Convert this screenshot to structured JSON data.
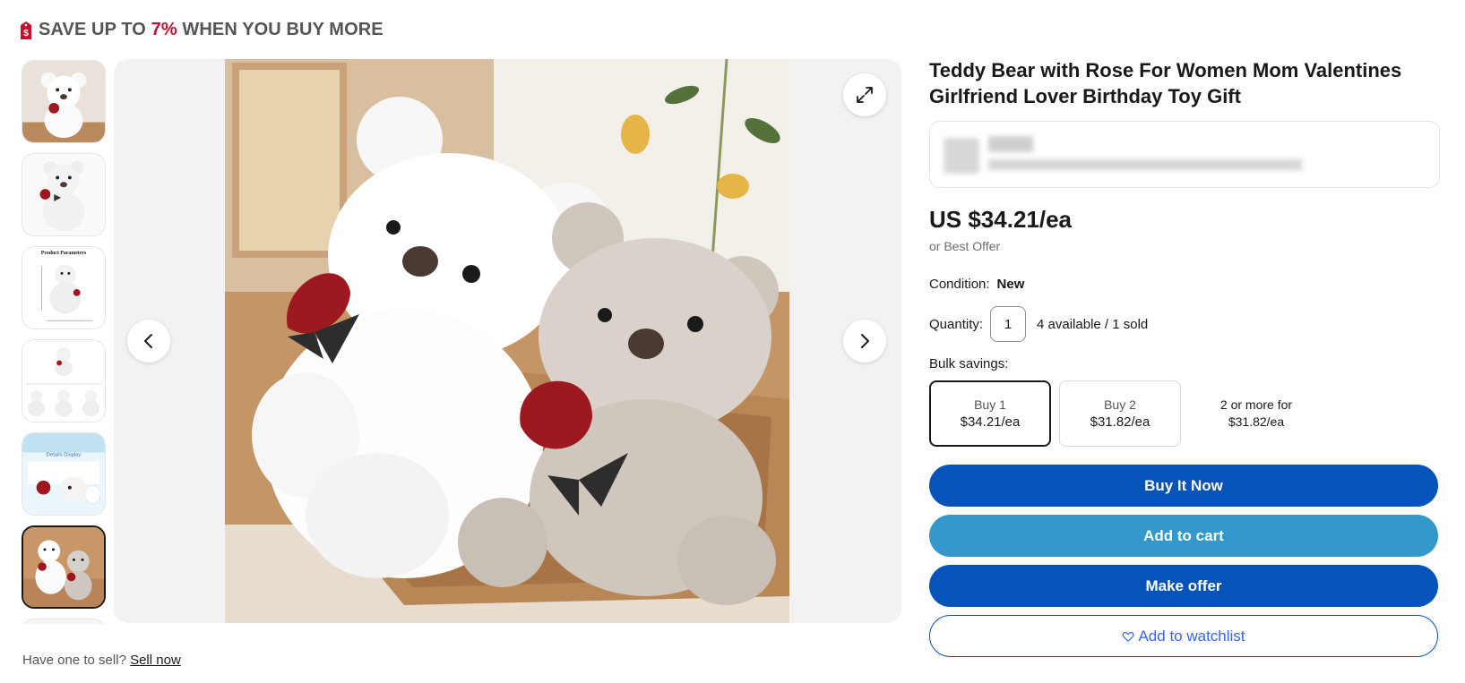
{
  "promo": {
    "prefix": "SAVE UP TO",
    "percent": "7%",
    "suffix": "WHEN YOU BUY MORE",
    "icon": "price-tag-icon",
    "accent": "#c8102e"
  },
  "gallery": {
    "thumbnails": [
      {
        "name": "thumbnail-1"
      },
      {
        "name": "thumbnail-2"
      },
      {
        "name": "thumbnail-3",
        "caption": "Product Parameters"
      },
      {
        "name": "thumbnail-4"
      },
      {
        "name": "thumbnail-5",
        "caption": "Details Display"
      },
      {
        "name": "thumbnail-6",
        "selected": true
      },
      {
        "name": "thumbnail-7"
      }
    ],
    "expand_icon": "expand-icon",
    "prev_icon": "chevron-left-icon",
    "next_icon": "chevron-right-icon"
  },
  "sell": {
    "prompt": "Have one to sell?",
    "link": "Sell now"
  },
  "product": {
    "title": "Teddy Bear with Rose For Women Mom Valentines Girlfriend Lover Birthday Toy Gift",
    "price": "US $34.21/ea",
    "best_offer": "or Best Offer",
    "condition_label": "Condition:",
    "condition_value": "New",
    "quantity_label": "Quantity:",
    "quantity_value": "1",
    "availability": "4 available / 1 sold",
    "bulk_label": "Bulk savings:",
    "bulk_options": [
      {
        "label": "Buy 1",
        "price": "$34.21/ea",
        "selected": true
      },
      {
        "label": "Buy 2",
        "price": "$31.82/ea",
        "selected": false
      }
    ],
    "bulk_note_line1": "2 or more for",
    "bulk_note_line2": "$31.82/ea"
  },
  "actions": {
    "buy_now": "Buy It Now",
    "add_to_cart": "Add to cart",
    "make_offer": "Make offer",
    "watchlist": "Add to watchlist",
    "watch_icon": "heart-icon",
    "colors": {
      "primary": "#0654ba",
      "secondary": "#3498ca",
      "link": "#3665f3"
    }
  }
}
